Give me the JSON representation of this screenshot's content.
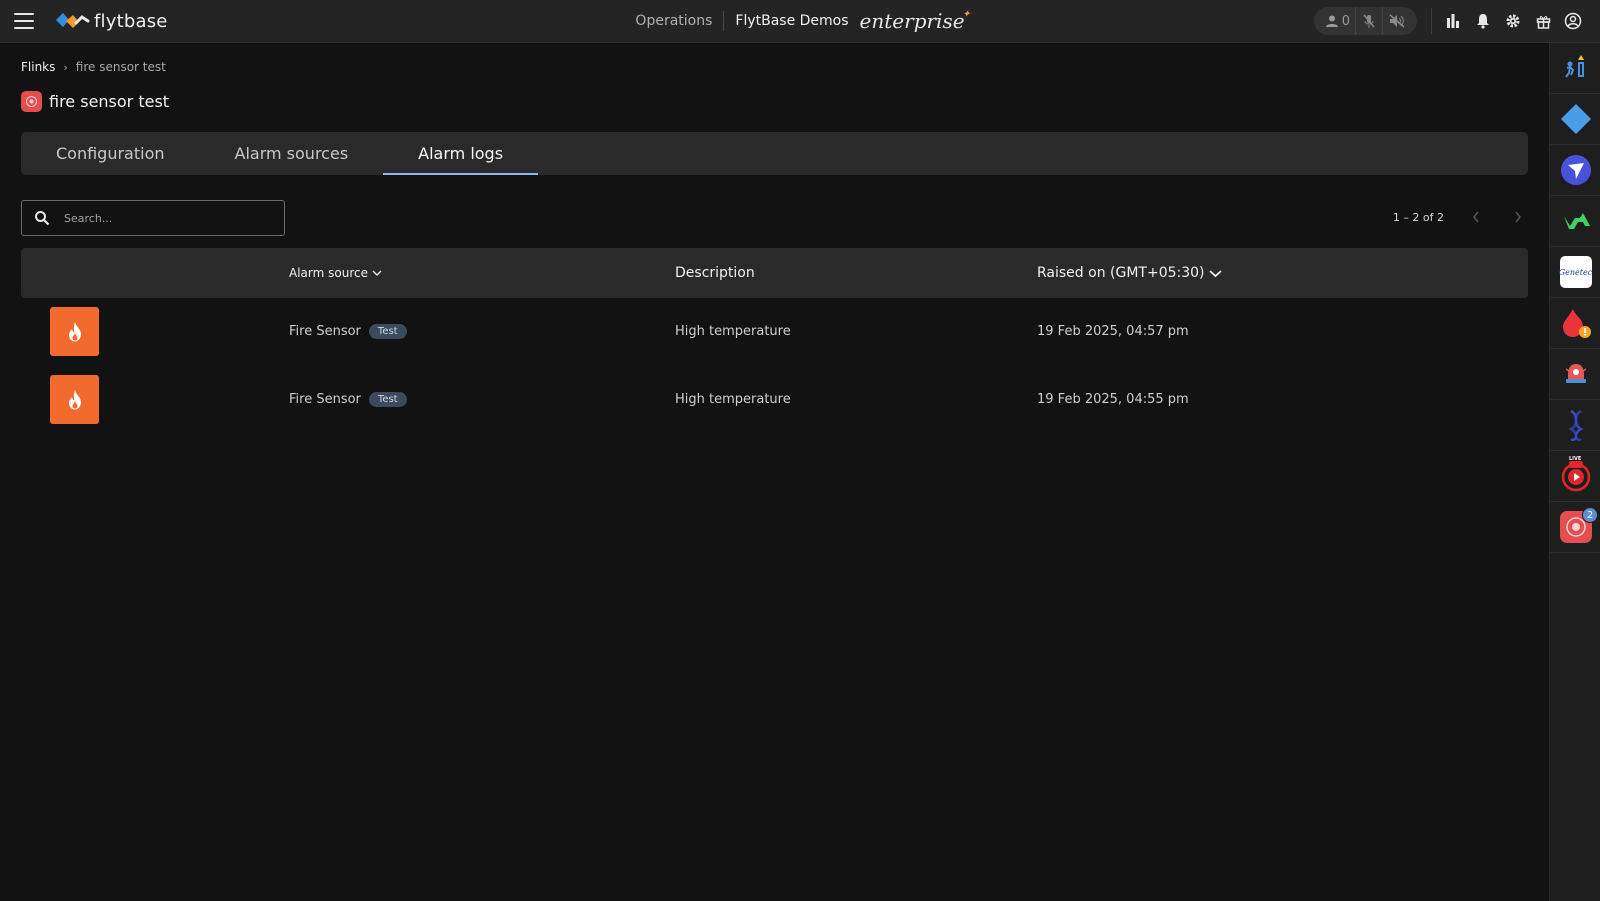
{
  "topbar": {
    "logo_text": "flytbase",
    "operations_label": "Operations",
    "org_name": "FlytBase Demos",
    "edition_label": "enterprise",
    "users_count": "0",
    "icons": [
      "menu-icon",
      "user-icon",
      "mic-off-icon",
      "speaker-off-icon",
      "analytics-icon",
      "bell-icon",
      "gear-icon",
      "gift-icon",
      "account-icon"
    ]
  },
  "breadcrumb": {
    "root": "Flinks",
    "current": "fire sensor test"
  },
  "page": {
    "title": "fire sensor test"
  },
  "tabs": [
    {
      "label": "Configuration",
      "active": false
    },
    {
      "label": "Alarm sources",
      "active": false
    },
    {
      "label": "Alarm logs",
      "active": true
    }
  ],
  "search": {
    "placeholder": "Search...",
    "value": ""
  },
  "pagination": {
    "range_label": "1 – 2 of 2"
  },
  "table": {
    "columns": {
      "source": "Alarm source",
      "description": "Description",
      "raised": "Raised on (GMT+05:30)"
    },
    "rows": [
      {
        "source": "Fire Sensor",
        "tag": "Test",
        "description": "High temperature",
        "raised": "19 Feb 2025, 04:57 pm"
      },
      {
        "source": "Fire Sensor",
        "tag": "Test",
        "description": "High temperature",
        "raised": "19 Feb 2025, 04:55 pm"
      }
    ]
  },
  "rail": {
    "items": [
      "person-alert-icon",
      "diamond-app-icon",
      "send-app-icon",
      "va-app-icon",
      "genetec-app-icon",
      "fire-alert-app-icon",
      "alarm-bell-app-icon",
      "dna-app-icon",
      "live-stream-app-icon",
      "fire-sensor-app-icon"
    ],
    "genetec_label": "Genetec",
    "live_label": "LIVE",
    "notification_count": "2"
  },
  "colors": {
    "accent": "#8fb6e8",
    "fire": "#f26a2e",
    "background": "#121212",
    "surface": "#2a2a2a"
  }
}
